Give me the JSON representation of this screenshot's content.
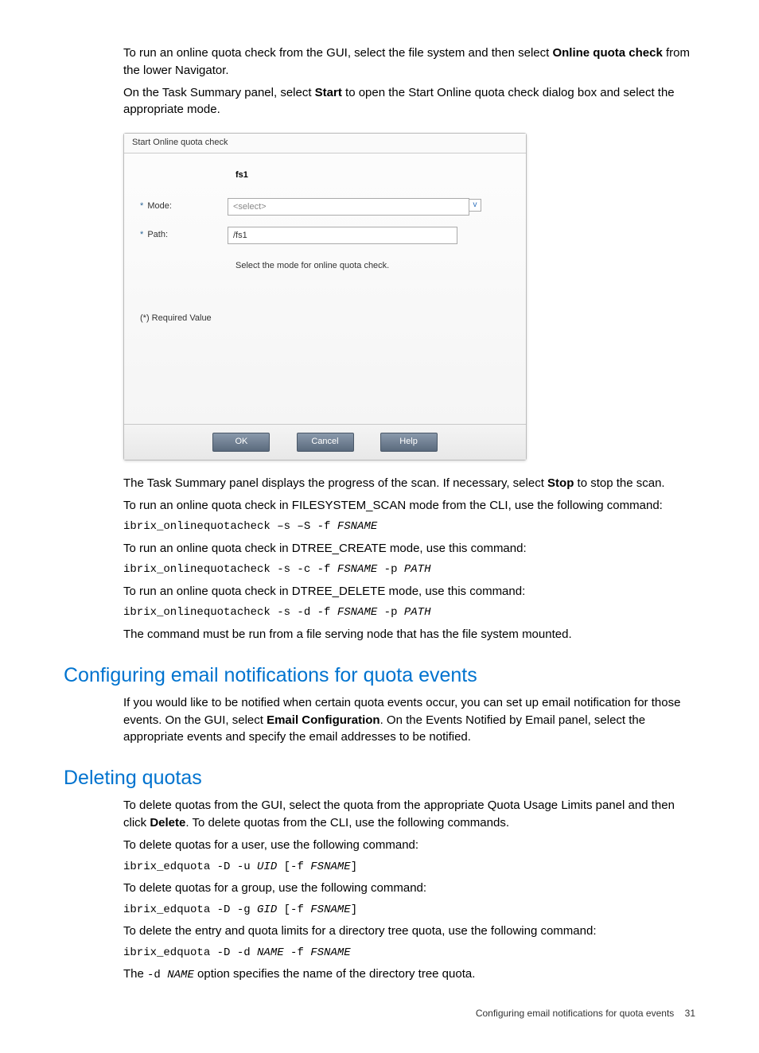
{
  "p1a": "To run an online quota check from the GUI, select the file system and then select ",
  "p1b": "Online quota check",
  "p1c": " from the lower Navigator.",
  "p2a": "On the Task Summary panel, select ",
  "p2b": "Start",
  "p2c": " to open the Start Online quota check dialog box and select the appropriate mode.",
  "dialog": {
    "title": "Start Online quota check",
    "fs": "fs1",
    "mode_label": "Mode:",
    "mode_placeholder": "<select>",
    "path_label": "Path:",
    "path_value": "/fs1",
    "hint": "Select the mode for online quota check.",
    "req": "(*) Required Value",
    "ok": "OK",
    "cancel": "Cancel",
    "help": "Help"
  },
  "p3a": "The Task Summary panel displays the progress of the scan. If necessary, select ",
  "p3b": "Stop",
  "p3c": " to stop the scan.",
  "p4": "To run an online quota check in FILESYSTEM_SCAN mode from the CLI, use the following command:",
  "cmd1a": "ibrix_onlinequotacheck –s –S -f ",
  "cmd1b": "FSNAME",
  "p5": "To run an online quota check in DTREE_CREATE mode, use this command:",
  "cmd2a": "ibrix_onlinequotacheck -s -c -f ",
  "cmd2b": "FSNAME",
  "cmd2c": " -p ",
  "cmd2d": "PATH",
  "p6": "To run an online quota check in DTREE_DELETE mode, use this command:",
  "cmd3a": "ibrix_onlinequotacheck -s -d -f ",
  "cmd3b": "FSNAME",
  "cmd3c": " -p ",
  "cmd3d": "PATH",
  "p7": "The command must be run from a file serving node that has the file system mounted.",
  "h2a": "Configuring email notifications for quota events",
  "p8a": "If you would like to be notified when certain quota events occur, you can set up email notification for those events. On the GUI, select ",
  "p8b": "Email Configuration",
  "p8c": ". On the Events Notified by Email panel, select the appropriate events and specify the email addresses to be notified.",
  "h2b": "Deleting quotas",
  "p9a": "To delete quotas from the GUI, select the quota from the appropriate Quota Usage Limits panel and then click ",
  "p9b": "Delete",
  "p9c": ". To delete quotas from the CLI, use the following commands.",
  "p10": "To delete quotas for a user, use the following command:",
  "cmd4a": "ibrix_edquota -D -u ",
  "cmd4b": "UID",
  "cmd4c": " [-f ",
  "cmd4d": "FSNAME",
  "cmd4e": "]",
  "p11": "To delete quotas for a group, use the following command:",
  "cmd5a": "ibrix_edquota -D -g ",
  "cmd5b": "GID",
  "cmd5c": " [-f ",
  "cmd5d": "FSNAME",
  "cmd5e": "]",
  "p12": "To delete the entry and quota limits for a directory tree quota, use the following command:",
  "cmd6a": "ibrix_edquota -D -d ",
  "cmd6b": "NAME",
  "cmd6c": " -f ",
  "cmd6d": "FSNAME",
  "p13a": "The ",
  "p13b": "-d ",
  "p13c": "NAME",
  "p13d": " option specifies the name of the directory tree quota.",
  "footer_text": "Configuring email notifications for quota events",
  "footer_page": "31"
}
